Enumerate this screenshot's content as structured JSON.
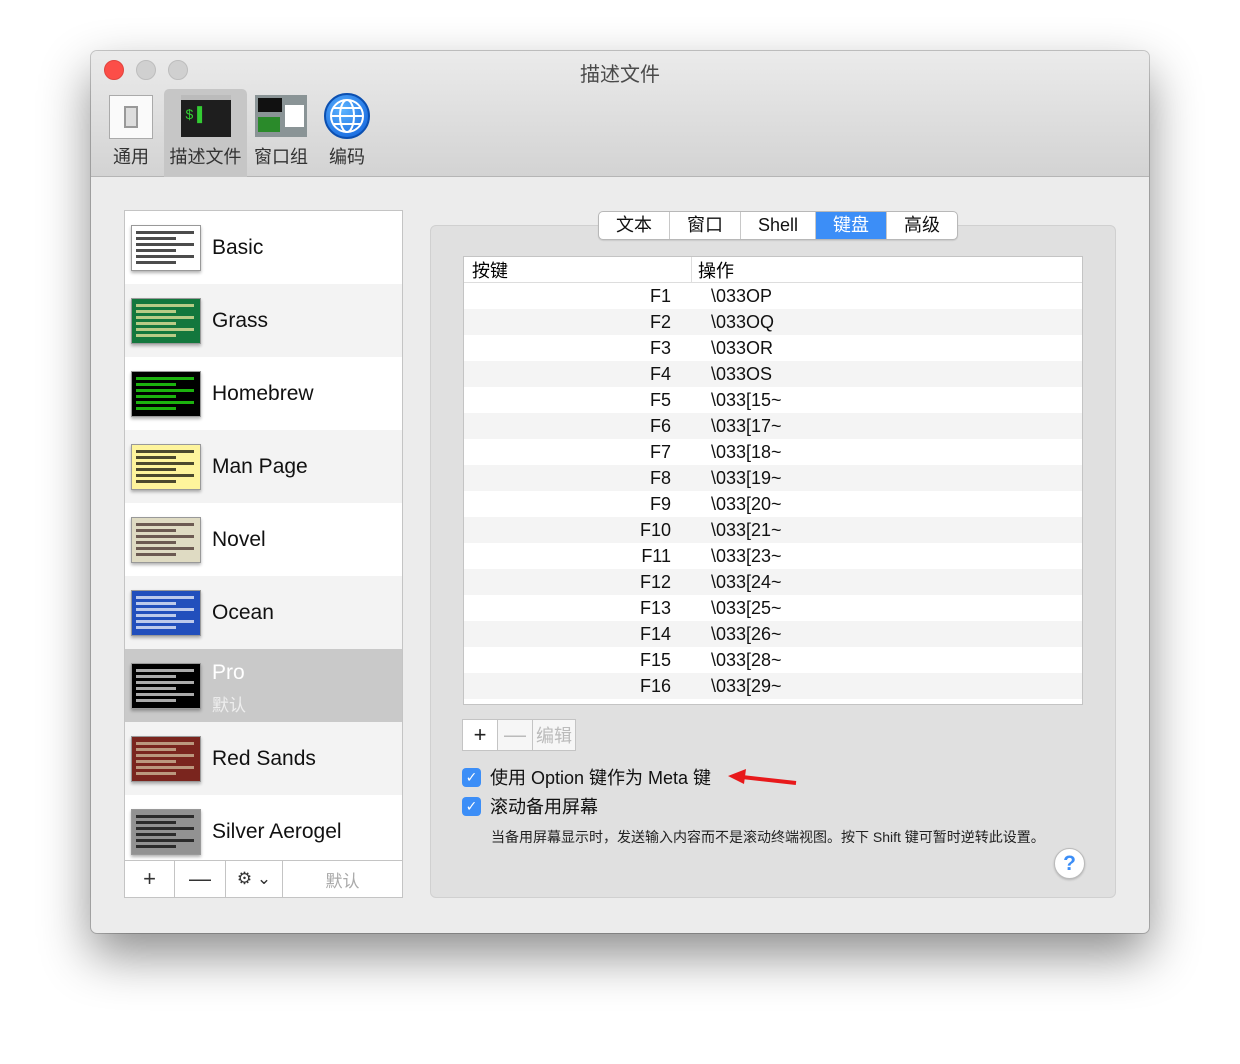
{
  "window": {
    "title": "描述文件"
  },
  "toolbar": [
    {
      "label": "通用",
      "icon": "switch-icon"
    },
    {
      "label": "描述文件",
      "icon": "terminal-icon",
      "selected": true
    },
    {
      "label": "窗口组",
      "icon": "window-group-icon"
    },
    {
      "label": "编码",
      "icon": "globe-icon"
    }
  ],
  "profiles": [
    {
      "name": "Basic",
      "bg": "#ffffff",
      "fg": "#000000"
    },
    {
      "name": "Grass",
      "bg": "#13773d",
      "fg": "#fff0a5"
    },
    {
      "name": "Homebrew",
      "bg": "#000000",
      "fg": "#28fe14"
    },
    {
      "name": "Man Page",
      "bg": "#fef49c",
      "fg": "#000000"
    },
    {
      "name": "Novel",
      "bg": "#dfdbc3",
      "fg": "#3b2322"
    },
    {
      "name": "Ocean",
      "bg": "#224fbc",
      "fg": "#ffffff"
    },
    {
      "name": "Pro",
      "bg": "#000000",
      "fg": "#f2f2f2",
      "selected": true,
      "sub": "默认"
    },
    {
      "name": "Red Sands",
      "bg": "#7a251e",
      "fg": "#d7c9a7"
    },
    {
      "name": "Silver Aerogel",
      "bg": "#929292",
      "fg": "#000000"
    }
  ],
  "sidebar_bar": {
    "add": "+",
    "remove": "—",
    "gear": "⚙ ⌄",
    "default": "默认"
  },
  "tabs": [
    {
      "label": "文本"
    },
    {
      "label": "窗口"
    },
    {
      "label": "Shell"
    },
    {
      "label": "键盘",
      "selected": true
    },
    {
      "label": "高级"
    }
  ],
  "table": {
    "headers": [
      "按键",
      "操作"
    ],
    "rows": [
      [
        "F1",
        "\\033OP"
      ],
      [
        "F2",
        "\\033OQ"
      ],
      [
        "F3",
        "\\033OR"
      ],
      [
        "F4",
        "\\033OS"
      ],
      [
        "F5",
        "\\033[15~"
      ],
      [
        "F6",
        "\\033[17~"
      ],
      [
        "F7",
        "\\033[18~"
      ],
      [
        "F8",
        "\\033[19~"
      ],
      [
        "F9",
        "\\033[20~"
      ],
      [
        "F10",
        "\\033[21~"
      ],
      [
        "F11",
        "\\033[23~"
      ],
      [
        "F12",
        "\\033[24~"
      ],
      [
        "F13",
        "\\033[25~"
      ],
      [
        "F14",
        "\\033[26~"
      ],
      [
        "F15",
        "\\033[28~"
      ],
      [
        "F16",
        "\\033[29~"
      ]
    ]
  },
  "actions": {
    "add": "+",
    "remove": "—",
    "edit": "编辑"
  },
  "options": {
    "option_meta": {
      "label": "使用 Option 键作为 Meta 键",
      "checked": true
    },
    "scroll_alt": {
      "label": "滚动备用屏幕",
      "checked": true
    },
    "description": "当备用屏幕显示时，发送输入内容而不是滚动终端视图。按下 Shift 键可暂时逆转此设置。"
  },
  "help": "?",
  "colors": {
    "accent": "#3c8ef7",
    "close": "#fc605c",
    "arrow": "#e8191b"
  }
}
